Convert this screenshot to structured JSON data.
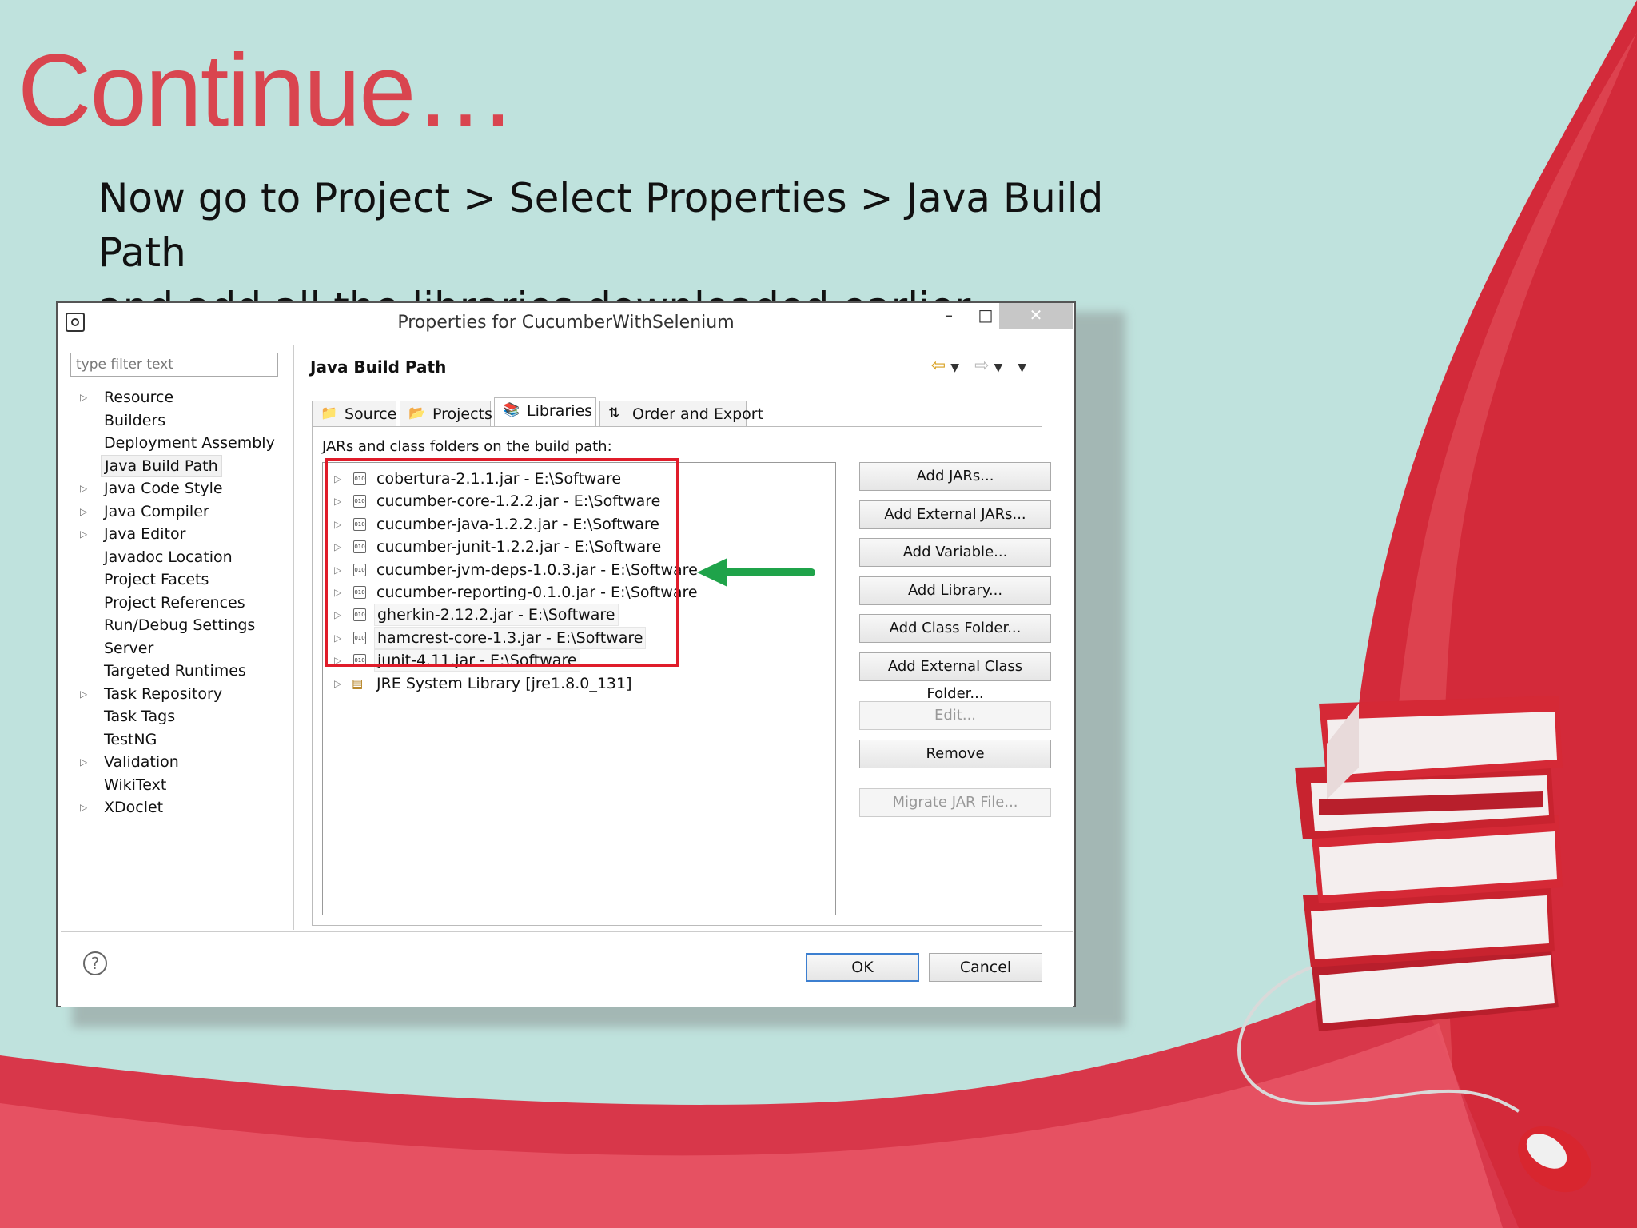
{
  "slide": {
    "title": "Continue…",
    "subtitle_line1": "Now go to Project > Select Properties > Java Build Path",
    "subtitle_line2": "and add all the libraries downloaded earlier",
    "colors": {
      "title": "#d9454f",
      "background": "#bfe2dd",
      "swoosh": "#d32a3a"
    }
  },
  "dialog": {
    "title": "Properties for CucumberWithSelenium",
    "window_controls": {
      "minimize": "–",
      "maximize": "□",
      "close": "✕"
    },
    "filter_placeholder": "type filter text",
    "tree": [
      {
        "label": "Resource",
        "expandable": true
      },
      {
        "label": "Builders",
        "expandable": false
      },
      {
        "label": "Deployment Assembly",
        "expandable": false
      },
      {
        "label": "Java Build Path",
        "expandable": false,
        "selected": true
      },
      {
        "label": "Java Code Style",
        "expandable": true
      },
      {
        "label": "Java Compiler",
        "expandable": true
      },
      {
        "label": "Java Editor",
        "expandable": true
      },
      {
        "label": "Javadoc Location",
        "expandable": false
      },
      {
        "label": "Project Facets",
        "expandable": false
      },
      {
        "label": "Project References",
        "expandable": false
      },
      {
        "label": "Run/Debug Settings",
        "expandable": false
      },
      {
        "label": "Server",
        "expandable": false
      },
      {
        "label": "Targeted Runtimes",
        "expandable": false
      },
      {
        "label": "Task Repository",
        "expandable": true
      },
      {
        "label": "Task Tags",
        "expandable": false
      },
      {
        "label": "TestNG",
        "expandable": false
      },
      {
        "label": "Validation",
        "expandable": true
      },
      {
        "label": "WikiText",
        "expandable": false
      },
      {
        "label": "XDoclet",
        "expandable": true
      }
    ],
    "page_title": "Java Build Path",
    "tabs": [
      {
        "label": "Source",
        "icon": "source-folder-icon"
      },
      {
        "label": "Projects",
        "icon": "projects-icon"
      },
      {
        "label": "Libraries",
        "icon": "libraries-icon",
        "active": true
      },
      {
        "label": "Order and Export",
        "icon": "order-export-icon"
      }
    ],
    "panel_label": "JARs and class folders on the build path:",
    "libraries": [
      {
        "label": "cobertura-2.1.1.jar - E:\\Software",
        "type": "jar"
      },
      {
        "label": "cucumber-core-1.2.2.jar - E:\\Software",
        "type": "jar"
      },
      {
        "label": "cucumber-java-1.2.2.jar - E:\\Software",
        "type": "jar"
      },
      {
        "label": "cucumber-junit-1.2.2.jar - E:\\Software",
        "type": "jar"
      },
      {
        "label": "cucumber-jvm-deps-1.0.3.jar - E:\\Software",
        "type": "jar"
      },
      {
        "label": "cucumber-reporting-0.1.0.jar - E:\\Software",
        "type": "jar"
      },
      {
        "label": "gherkin-2.12.2.jar - E:\\Software",
        "type": "jar",
        "highlight": true
      },
      {
        "label": "hamcrest-core-1.3.jar - E:\\Software",
        "type": "jar",
        "highlight": true
      },
      {
        "label": "junit-4.11.jar - E:\\Software",
        "type": "jar",
        "highlight": true
      },
      {
        "label": "JRE System Library [jre1.8.0_131]",
        "type": "jre"
      }
    ],
    "side_buttons": [
      {
        "label": "Add JARs...",
        "enabled": true
      },
      {
        "label": "Add External JARs...",
        "enabled": true
      },
      {
        "label": "Add Variable...",
        "enabled": true
      },
      {
        "label": "Add Library...",
        "enabled": true
      },
      {
        "label": "Add Class Folder...",
        "enabled": true
      },
      {
        "label": "Add External Class Folder...",
        "enabled": true
      },
      {
        "label": "Edit...",
        "enabled": false
      },
      {
        "label": "Remove",
        "enabled": true
      },
      {
        "label": "Migrate JAR File...",
        "enabled": false
      }
    ],
    "help_icon": "?",
    "ok_label": "OK",
    "cancel_label": "Cancel",
    "annotation": {
      "box_color": "#e01c2a",
      "arrow_color": "#1fa34a"
    }
  }
}
